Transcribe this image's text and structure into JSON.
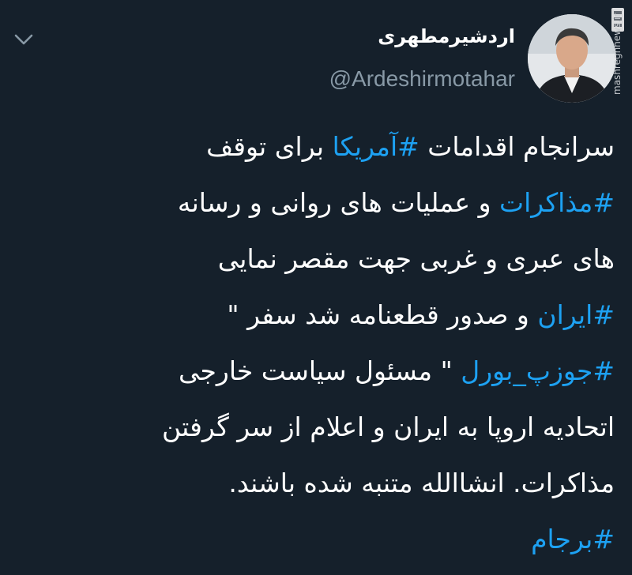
{
  "tweet": {
    "display_name": "اردشیرمطهری",
    "handle": "@Ardeshirmotahar",
    "watermark_logo": "مشرق",
    "watermark_url": "mashreghnews.ir",
    "body": {
      "l1_a": "سرانجام اقدامات ",
      "l1_tag": "#آمریکا",
      "l1_b": " برای توقف",
      "l2_tag": "#مذاکرات",
      "l2_b": " و عملیات های روانی و رسانه",
      "l3": "های عبری و غربی جهت مقصر نمایی",
      "l4_tag": "#ایران",
      "l4_b": " و صدور قطعنامه شد سفر \"",
      "l5_tag": "#جوزپ_بورل",
      "l5_b": " \" مسئول سیاست خارجی",
      "l6": "اتحادیه اروپا به ایران و اعلام از سر گرفتن",
      "l7": "مذاکرات. انشاالله متنبه شده باشند.",
      "l8_tag": "#برجام"
    }
  },
  "icons": {
    "menu": "chevron-down-icon",
    "avatar": "profile-photo"
  },
  "colors": {
    "background": "#15202b",
    "text": "#ffffff",
    "secondary": "#8899a6",
    "link": "#1da1f2"
  }
}
